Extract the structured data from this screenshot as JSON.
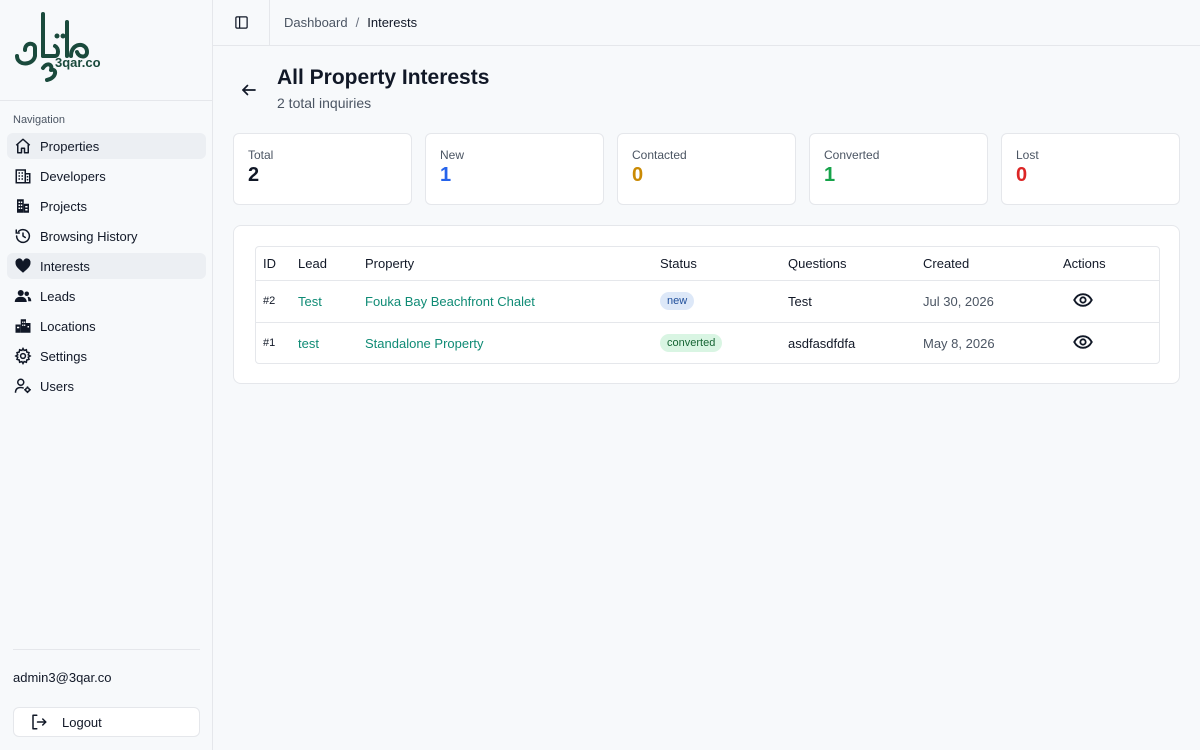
{
  "brand": {
    "logo_text_arabic": "عقارتو",
    "logo_text_latin": "3qar.co",
    "color": "#1a4a3c"
  },
  "sidebar": {
    "heading": "Navigation",
    "items": [
      {
        "label": "Properties",
        "icon": "home-icon",
        "active": true
      },
      {
        "label": "Developers",
        "icon": "building-icon",
        "active": false
      },
      {
        "label": "Projects",
        "icon": "buildings-icon",
        "active": false
      },
      {
        "label": "Browsing History",
        "icon": "history-icon",
        "active": false
      },
      {
        "label": "Interests",
        "icon": "heart-icon",
        "active": true
      },
      {
        "label": "Leads",
        "icon": "users-icon",
        "active": false
      },
      {
        "label": "Locations",
        "icon": "city-icon",
        "active": false
      },
      {
        "label": "Settings",
        "icon": "gear-icon",
        "active": false
      },
      {
        "label": "Users",
        "icon": "user-cog-icon",
        "active": false
      }
    ],
    "user_email": "admin3@3qar.co",
    "logout_label": "Logout"
  },
  "topbar": {
    "breadcrumb": {
      "root": "Dashboard",
      "separator": "/",
      "current": "Interests"
    }
  },
  "header": {
    "title": "All Property Interests",
    "subtitle": "2 total inquiries"
  },
  "stats": [
    {
      "label": "Total",
      "value": "2",
      "color": "#111827"
    },
    {
      "label": "New",
      "value": "1",
      "color": "#2563eb"
    },
    {
      "label": "Contacted",
      "value": "0",
      "color": "#ca8a04"
    },
    {
      "label": "Converted",
      "value": "1",
      "color": "#16a34a"
    },
    {
      "label": "Lost",
      "value": "0",
      "color": "#dc2626"
    }
  ],
  "table": {
    "columns": [
      "ID",
      "Lead",
      "Property",
      "Status",
      "Questions",
      "Created",
      "Actions"
    ],
    "rows": [
      {
        "id": "#2",
        "lead": "Test",
        "property": "Fouka Bay Beachfront Chalet",
        "status": "new",
        "questions": "Test",
        "created": "Jul 30, 2026"
      },
      {
        "id": "#1",
        "lead": "test",
        "property": "Standalone Property",
        "status": "converted",
        "questions": "asdfasdfdfa",
        "created": "May 8, 2026"
      }
    ]
  },
  "colors": {
    "link": "#0f8b75",
    "badge_new_bg": "#dde8f8",
    "badge_converted_bg": "#d9f5e3"
  }
}
